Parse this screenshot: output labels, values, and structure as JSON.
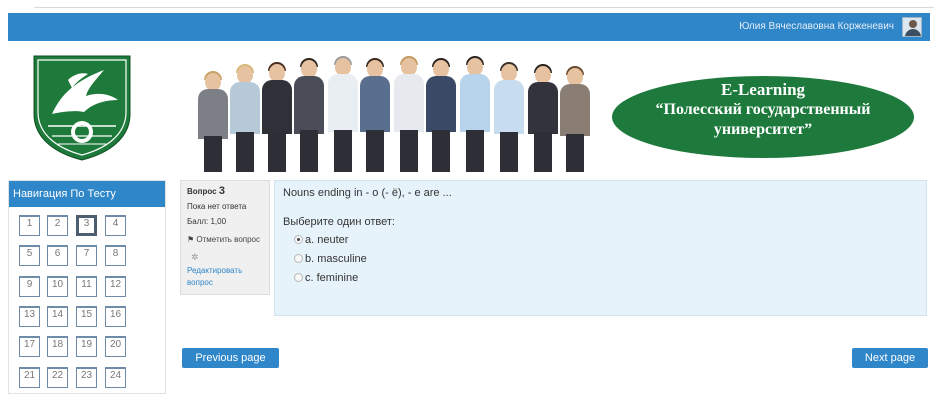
{
  "header": {
    "user_name": "Юлия Вячеславовна Корженевич",
    "accent_color": "#2f86c8"
  },
  "logo": {
    "icon": "university-crest-icon"
  },
  "banner": {
    "line1": "E-Learning",
    "line2": "“Полесский государственный",
    "line3": "университет”"
  },
  "navigation": {
    "title": "Навигация По Тесту",
    "questions": [
      "1",
      "2",
      "3",
      "4",
      "5",
      "6",
      "7",
      "8",
      "9",
      "10",
      "11",
      "12",
      "13",
      "14",
      "15",
      "16",
      "17",
      "18",
      "19",
      "20",
      "21",
      "22",
      "23",
      "24"
    ],
    "current": "3"
  },
  "question_info": {
    "label": "Вопрос",
    "number": "3",
    "status": "Пока нет ответа",
    "grade": "Балл: 1,00",
    "flag_label": "Отметить вопрос",
    "edit_label": "Редактировать вопрос"
  },
  "question": {
    "text": "Nouns ending in - o (- ё), - e  are ...",
    "prompt": "Выберите один ответ:",
    "answers": [
      {
        "label": "a. neuter",
        "checked": true
      },
      {
        "label": "b. masculine",
        "checked": false
      },
      {
        "label": "c. feminine",
        "checked": false
      }
    ]
  },
  "footer": {
    "previous_label": "Previous page",
    "next_label": "Next page"
  }
}
